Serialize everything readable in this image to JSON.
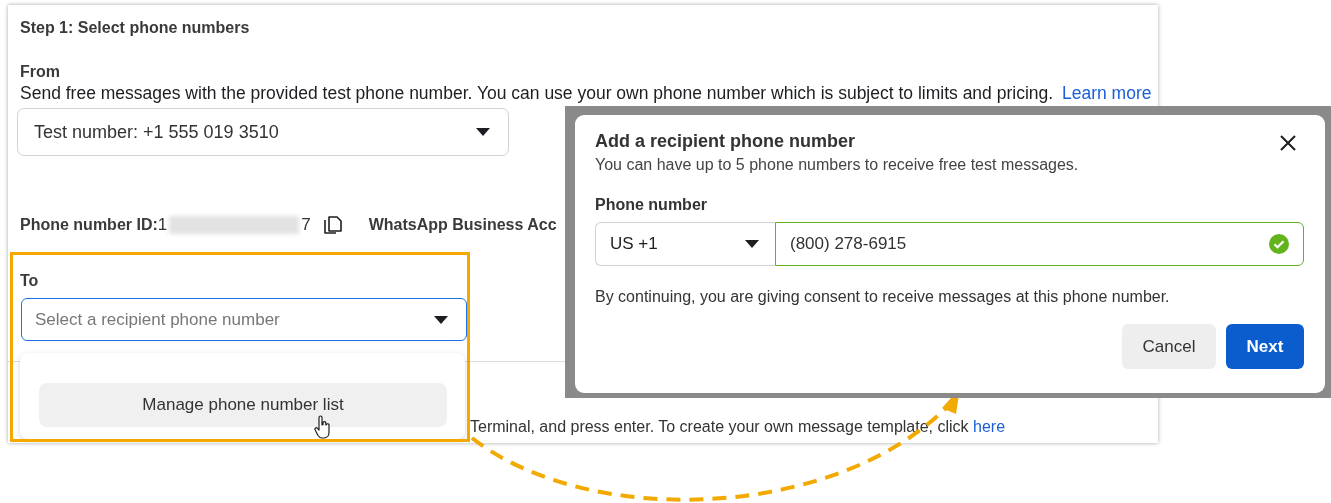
{
  "page": {
    "step_title": "Step 1: Select phone numbers",
    "from": {
      "label": "From",
      "description": "Send free messages with the provided test phone number. You can use your own phone number which is subject to limits and pricing.",
      "link": "Learn more",
      "value": "Test number: +1 555 019 3510"
    },
    "phone_id": {
      "label": "Phone number ID:",
      "first": "1",
      "last": "7"
    },
    "account_label": "WhatsApp Business Acc",
    "to": {
      "label": "To",
      "placeholder": "Select a recipient phone number",
      "focused": true
    },
    "menu": {
      "item": "Manage phone number list"
    },
    "footer": {
      "text": "Terminal, and press enter. To create your own message template, click",
      "link": "here"
    }
  },
  "dialog": {
    "title": "Add a recipient phone number",
    "subtitle": "You can have up to 5 phone numbers to receive free test messages.",
    "field_label": "Phone number",
    "country": "US +1",
    "phone": "(800) 278-6915",
    "valid": true,
    "consent": "By continuing, you are giving consent to receive messages at this phone number.",
    "buttons": [
      {
        "label": "Cancel",
        "kind": "secondary"
      },
      {
        "label": "Next",
        "kind": "primary"
      }
    ]
  }
}
